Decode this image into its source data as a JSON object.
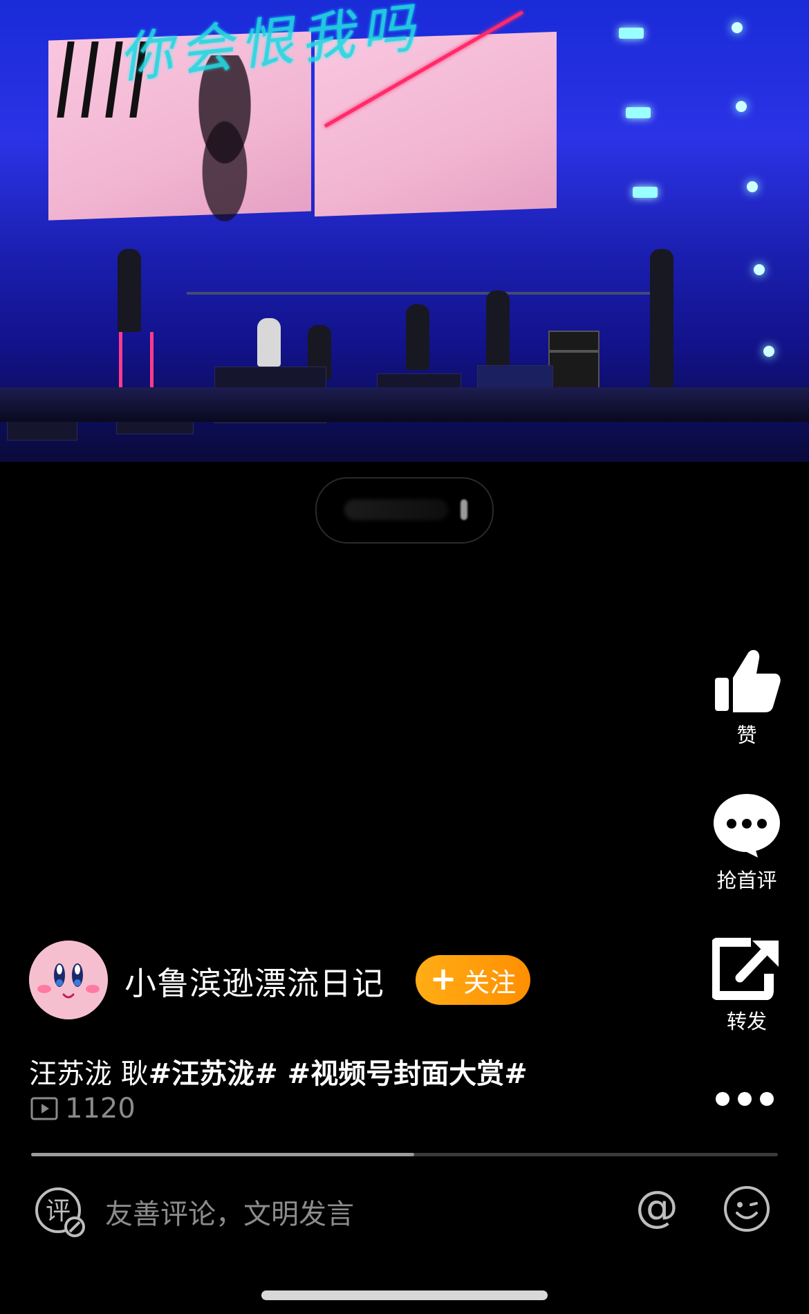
{
  "rail": {
    "like": {
      "label": "赞",
      "icon": "thumbs-up-icon"
    },
    "comment": {
      "label": "抢首评",
      "icon": "chat-bubble-icon"
    },
    "share": {
      "label": "转发",
      "icon": "share-icon"
    },
    "more": {
      "icon": "more-dots-icon"
    }
  },
  "author": {
    "name": "小鲁滨逊漂流日记",
    "follow_plus": "+",
    "follow_label": "关注"
  },
  "caption": {
    "prefix": "汪苏泷 耿",
    "tags": "#汪苏泷# #视频号封面大赏#"
  },
  "stats": {
    "views": "1120"
  },
  "playback": {
    "progress": 0.513
  },
  "comment_bar": {
    "placeholder": "友善评论，文明发言",
    "comment_icon_char": "评",
    "at_char": "@"
  },
  "colors": {
    "follow_button": "#ff9a0a",
    "background": "#000000",
    "muted_text": "#8b8b8b"
  }
}
